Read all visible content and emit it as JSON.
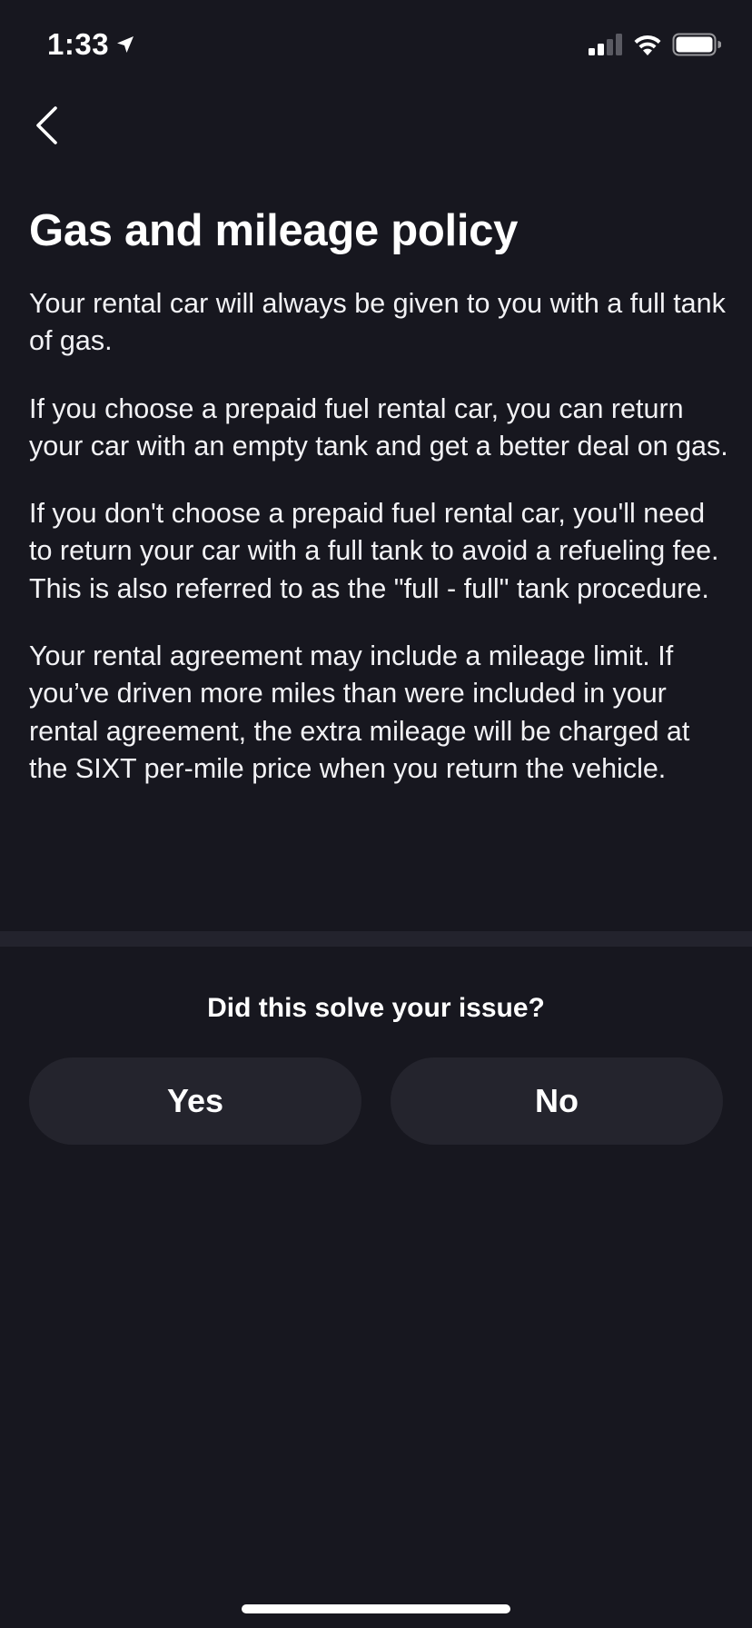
{
  "status_bar": {
    "time": "1:33"
  },
  "header": {
    "back_icon": "chevron-left-icon"
  },
  "page": {
    "title": "Gas and mileage policy",
    "paragraphs": [
      "Your rental car will always be given to you with a full tank of gas.",
      "If you choose a prepaid fuel rental car, you can return your car with an empty tank and get a better deal on gas.",
      "If you don't choose a prepaid fuel rental car, you'll need to return your car with a full tank to avoid a refueling fee. This is also referred to as the \"full - full\" tank procedure.",
      "Your rental agreement may include a mileage limit. If you’ve driven more miles than were included in your rental agreement, the extra mileage will be charged at the SIXT per-mile price when you return the vehicle."
    ]
  },
  "feedback": {
    "question": "Did this solve your issue?",
    "yes_label": "Yes",
    "no_label": "No"
  },
  "colors": {
    "background": "#17171f",
    "button_bg": "#24242d",
    "divider": "#23232d",
    "text": "#ffffff"
  }
}
